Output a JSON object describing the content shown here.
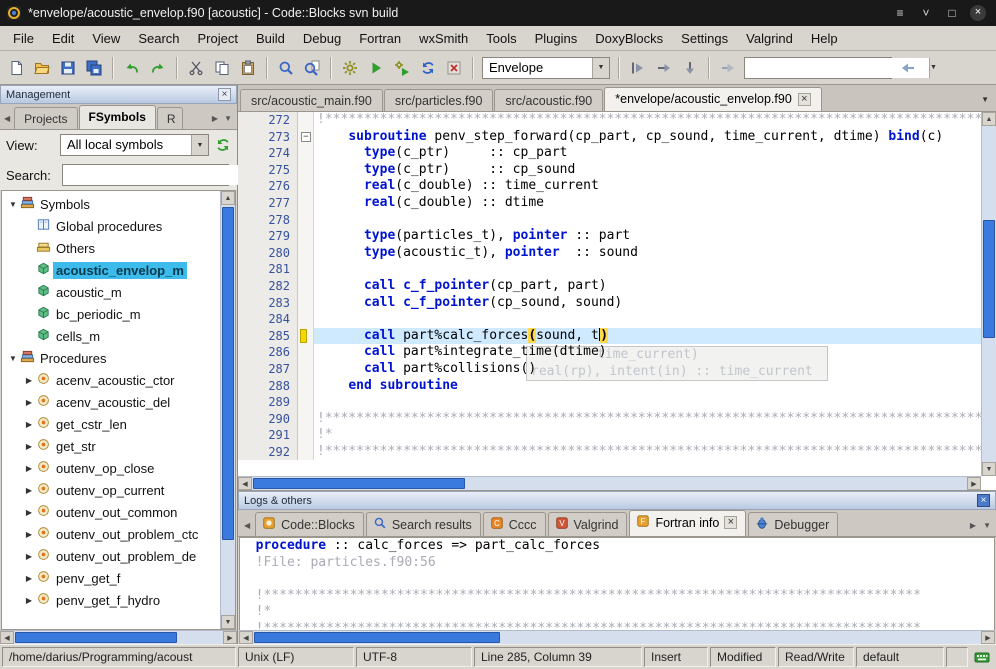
{
  "window": {
    "title": "*envelope/acoustic_envelop.f90 [acoustic] - Code::Blocks svn build"
  },
  "menubar": {
    "items": [
      "File",
      "Edit",
      "View",
      "Search",
      "Project",
      "Build",
      "Debug",
      "Fortran",
      "wxSmith",
      "Tools",
      "Plugins",
      "DoxyBlocks",
      "Settings",
      "Valgrind",
      "Help"
    ]
  },
  "toolbar": {
    "groups": [
      [
        "new-file",
        "open-file",
        "save",
        "save-all"
      ],
      [
        "undo",
        "redo"
      ],
      [
        "cut",
        "copy",
        "paste"
      ],
      [
        "find",
        "find-in-files"
      ],
      [
        "build",
        "run",
        "build-run",
        "rebuild",
        "abort"
      ]
    ],
    "target_combo": {
      "value": "Envelope"
    },
    "debug_icons": [
      "dbg-run-to",
      "dbg-next",
      "dbg-step"
    ],
    "goto_icon": "dbg-cont",
    "search_input": {
      "value": ""
    },
    "trailing_icon": "back-arrow"
  },
  "management": {
    "header": "Management",
    "tabs": [
      {
        "label": "Projects",
        "active": false
      },
      {
        "label": "FSymbols",
        "active": true
      },
      {
        "label": "R",
        "active": false,
        "cut": true
      }
    ],
    "view": {
      "label": "View:",
      "value": "All local symbols"
    },
    "search": {
      "label": "Search:",
      "value": ""
    },
    "tree": [
      {
        "depth": 0,
        "exp": "down",
        "icon": "books",
        "label": "Symbols"
      },
      {
        "depth": 1,
        "exp": "",
        "icon": "book",
        "label": "Global procedures"
      },
      {
        "depth": 1,
        "exp": "",
        "icon": "books2",
        "label": "Others"
      },
      {
        "depth": 1,
        "exp": "",
        "icon": "module",
        "label": "acoustic_envelop_m",
        "selected": true
      },
      {
        "depth": 1,
        "exp": "",
        "icon": "module",
        "label": "acoustic_m"
      },
      {
        "depth": 1,
        "exp": "",
        "icon": "module",
        "label": "bc_periodic_m"
      },
      {
        "depth": 1,
        "exp": "",
        "icon": "module",
        "label": "cells_m"
      },
      {
        "depth": 0,
        "exp": "down",
        "icon": "books",
        "label": "Procedures"
      },
      {
        "depth": 1,
        "exp": "right",
        "icon": "proc",
        "label": "acenv_acoustic_ctor"
      },
      {
        "depth": 1,
        "exp": "right",
        "icon": "proc",
        "label": "acenv_acoustic_del"
      },
      {
        "depth": 1,
        "exp": "right",
        "icon": "proc",
        "label": "get_cstr_len"
      },
      {
        "depth": 1,
        "exp": "right",
        "icon": "proc",
        "label": "get_str"
      },
      {
        "depth": 1,
        "exp": "right",
        "icon": "proc",
        "label": "outenv_op_close"
      },
      {
        "depth": 1,
        "exp": "right",
        "icon": "proc",
        "label": "outenv_op_current"
      },
      {
        "depth": 1,
        "exp": "right",
        "icon": "proc",
        "label": "outenv_out_common"
      },
      {
        "depth": 1,
        "exp": "right",
        "icon": "proc",
        "label": "outenv_out_problem_ctc"
      },
      {
        "depth": 1,
        "exp": "right",
        "icon": "proc",
        "label": "outenv_out_problem_de"
      },
      {
        "depth": 1,
        "exp": "right",
        "icon": "proc",
        "label": "penv_get_f"
      },
      {
        "depth": 1,
        "exp": "right",
        "icon": "proc",
        "label": "penv_get_f_hydro"
      }
    ]
  },
  "editor": {
    "tabs": [
      {
        "label": "src/acoustic_main.f90",
        "active": false
      },
      {
        "label": "src/particles.f90",
        "active": false
      },
      {
        "label": "src/acoustic.f90",
        "active": false
      },
      {
        "label": "*envelope/acoustic_envelop.f90",
        "active": true,
        "closable": true
      }
    ],
    "lines": [
      {
        "n": 272,
        "seg": [
          [
            "c",
            "!**************************************************************************************************"
          ]
        ]
      },
      {
        "n": 273,
        "fold": true,
        "seg": [
          [
            "p",
            "    "
          ],
          [
            "k",
            "subroutine"
          ],
          [
            "p",
            " penv_step_forward(cp_part, cp_sound, time_current, dtime) "
          ],
          [
            "k",
            "bind"
          ],
          [
            "p",
            "(c)"
          ]
        ]
      },
      {
        "n": 274,
        "seg": [
          [
            "p",
            "      "
          ],
          [
            "k",
            "type"
          ],
          [
            "p",
            "(c_ptr)     :: cp_part"
          ]
        ]
      },
      {
        "n": 275,
        "seg": [
          [
            "p",
            "      "
          ],
          [
            "k",
            "type"
          ],
          [
            "p",
            "(c_ptr)     :: cp_sound"
          ]
        ]
      },
      {
        "n": 276,
        "seg": [
          [
            "p",
            "      "
          ],
          [
            "k",
            "real"
          ],
          [
            "p",
            "(c_double) :: time_current"
          ]
        ]
      },
      {
        "n": 277,
        "seg": [
          [
            "p",
            "      "
          ],
          [
            "k",
            "real"
          ],
          [
            "p",
            "(c_double) :: dtime"
          ]
        ]
      },
      {
        "n": 278,
        "seg": []
      },
      {
        "n": 279,
        "seg": [
          [
            "p",
            "      "
          ],
          [
            "k",
            "type"
          ],
          [
            "p",
            "(particles_t), "
          ],
          [
            "k",
            "pointer"
          ],
          [
            "p",
            " :: part"
          ]
        ]
      },
      {
        "n": 280,
        "seg": [
          [
            "p",
            "      "
          ],
          [
            "k",
            "type"
          ],
          [
            "p",
            "(acoustic_t), "
          ],
          [
            "k",
            "pointer"
          ],
          [
            "p",
            "  :: sound"
          ]
        ]
      },
      {
        "n": 281,
        "seg": []
      },
      {
        "n": 282,
        "seg": [
          [
            "p",
            "      "
          ],
          [
            "k",
            "call"
          ],
          [
            "p",
            " "
          ],
          [
            "k",
            "c_f_pointer"
          ],
          [
            "p",
            "(cp_part, part)"
          ]
        ]
      },
      {
        "n": 283,
        "seg": [
          [
            "p",
            "      "
          ],
          [
            "k",
            "call"
          ],
          [
            "p",
            " "
          ],
          [
            "k",
            "c_f_pointer"
          ],
          [
            "p",
            "(cp_sound, sound)"
          ]
        ]
      },
      {
        "n": 284,
        "seg": []
      },
      {
        "n": 285,
        "current": true,
        "marker": true,
        "seg": [
          [
            "p",
            "      "
          ],
          [
            "k",
            "call"
          ],
          [
            "p",
            " part%calc_forces"
          ],
          [
            "m",
            "("
          ],
          [
            "p",
            "sound, t"
          ],
          [
            "x",
            ""
          ],
          [
            "m",
            ")"
          ]
        ]
      },
      {
        "n": 286,
        "seg": [
          [
            "p",
            "      "
          ],
          [
            "k",
            "call"
          ],
          [
            "p",
            " part%integrate_time(dtime)"
          ]
        ]
      },
      {
        "n": 287,
        "seg": [
          [
            "p",
            "      "
          ],
          [
            "k",
            "call"
          ],
          [
            "p",
            " part%collisions()"
          ]
        ]
      },
      {
        "n": 288,
        "seg": [
          [
            "p",
            "    "
          ],
          [
            "k",
            "end subroutine"
          ]
        ]
      },
      {
        "n": 289,
        "seg": []
      },
      {
        "n": 290,
        "seg": [
          [
            "c",
            "!**************************************************************************************************"
          ]
        ]
      },
      {
        "n": 291,
        "seg": [
          [
            "c",
            "!*"
          ]
        ]
      },
      {
        "n": 292,
        "seg": [
          [
            "c",
            "!**************************************************************************************************"
          ]
        ]
      }
    ],
    "calltip": {
      "line1": "time_current)",
      "line2": "real(rp), intent(in) :: time_current"
    },
    "cursor": {
      "line": 285,
      "column": 39
    }
  },
  "logs": {
    "header": "Logs & others",
    "tabs": [
      {
        "label": "Code::Blocks",
        "icon": "tab-cb",
        "active": false
      },
      {
        "label": "Search results",
        "icon": "tab-search",
        "active": false
      },
      {
        "label": "Cccc",
        "icon": "tab-cccc",
        "active": false
      },
      {
        "label": "Valgrind",
        "icon": "tab-valgrind",
        "active": false
      },
      {
        "label": "Fortran info",
        "icon": "tab-fortran",
        "active": true,
        "closable": true
      },
      {
        "label": "Debugger",
        "icon": "tab-debugger",
        "active": false
      }
    ],
    "lines": [
      {
        "seg": [
          [
            "p",
            "  "
          ],
          [
            "k",
            "procedure"
          ],
          [
            "p",
            " :: calc_forces => part_calc_forces"
          ]
        ]
      },
      {
        "seg": [
          [
            "c",
            "  !File: particles.f90:56"
          ]
        ]
      },
      {
        "seg": []
      },
      {
        "seg": [
          [
            "c",
            "  !************************************************************************************"
          ]
        ]
      },
      {
        "seg": [
          [
            "c",
            "  !*"
          ]
        ]
      },
      {
        "seg": [
          [
            "c",
            "  !************************************************************************************"
          ]
        ]
      }
    ]
  },
  "statusbar": {
    "segments": [
      "/home/darius/Programming/acoust",
      "Unix (LF)",
      "UTF-8",
      "Line 285, Column 39",
      "Insert",
      "Modified",
      "Read/Write",
      "default"
    ]
  }
}
